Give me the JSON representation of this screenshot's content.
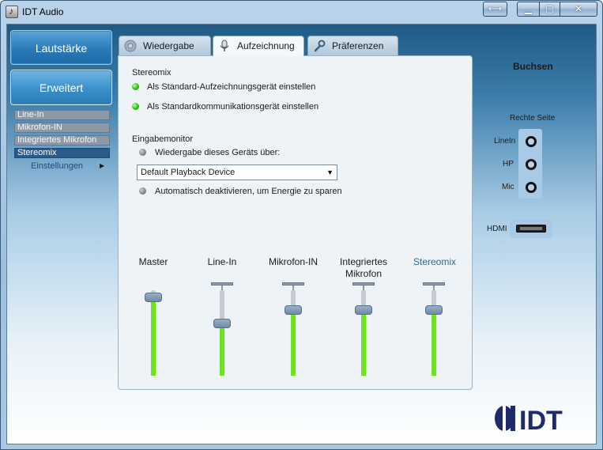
{
  "window": {
    "title": "IDT Audio",
    "controls": {
      "restore_alt": "⟷",
      "minimize": "▁",
      "maximize": "▢",
      "close": "✕"
    }
  },
  "sidebar": {
    "lautstaerke": "Lautstärke",
    "erweitert": "Erweitert",
    "devices": [
      "Line-In",
      "Mikrofon-IN",
      "Integriertes Mikrofon",
      "Stereomix"
    ],
    "selected_device": "Stereomix",
    "einstellungen": "Einstellungen"
  },
  "tabs": [
    {
      "label": "Wiedergabe",
      "icon": "speaker-icon"
    },
    {
      "label": "Aufzeichnung",
      "icon": "microphone-icon",
      "active": true
    },
    {
      "label": "Präferenzen",
      "icon": "wrench-icon"
    }
  ],
  "panel": {
    "stereomix_title": "Stereomix",
    "option_default_recording": "Als Standard-Aufzeichnungsgerät einstellen",
    "option_default_comm": "Als Standardkommunikationsgerät einstellen",
    "eingabemonitor_title": "Eingabemonitor",
    "option_playback_through": "Wiedergabe dieses Geräts über:",
    "playback_device_selected": "Default Playback Device",
    "option_auto_disable": "Automatisch deaktivieren, um Energie zu sparen"
  },
  "mixer": {
    "channels": [
      {
        "label": "Master",
        "level": 0.92,
        "has_mute_bar": false,
        "active": false
      },
      {
        "label": "Line-In",
        "level": 0.61,
        "has_mute_bar": true,
        "active": false
      },
      {
        "label": "Mikrofon-IN",
        "level": 0.77,
        "has_mute_bar": true,
        "active": false
      },
      {
        "label": "Integriertes Mikrofon",
        "level": 0.77,
        "has_mute_bar": true,
        "active": false
      },
      {
        "label": "Stereomix",
        "level": 0.77,
        "has_mute_bar": true,
        "active": true
      }
    ]
  },
  "jacks": {
    "title": "Buchsen",
    "side": "Rechte Seite",
    "ports": [
      "LineIn",
      "HP",
      "Mic"
    ],
    "hdmi": "HDMI"
  },
  "logo_text": "IDT",
  "colors": {
    "level_green": "#6be51a",
    "accent_blue": "#2e6b94"
  }
}
